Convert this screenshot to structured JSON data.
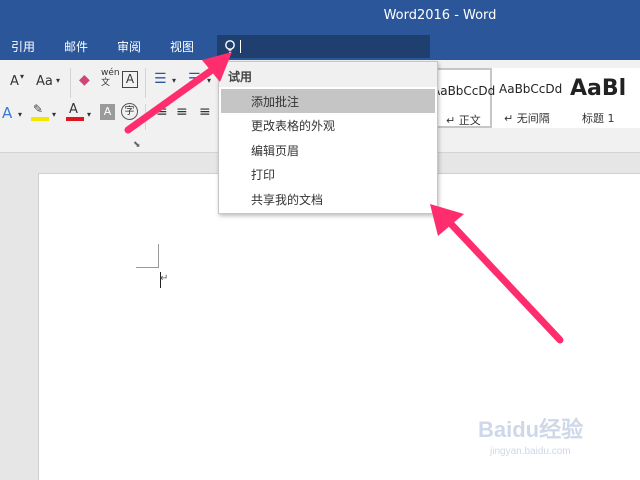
{
  "window": {
    "title": "Word2016 - Word"
  },
  "tabs": [
    {
      "label": "引用"
    },
    {
      "label": "邮件"
    },
    {
      "label": "审阅"
    },
    {
      "label": "视图"
    }
  ],
  "tellme": {
    "value": ""
  },
  "ribbon": {
    "font_size_up": "A",
    "case_button": "Aa",
    "phonetic_top": "wén",
    "phonetic_bottom": "文",
    "char_border": "A",
    "text_effects": "A",
    "font_color": "A",
    "char_shading": "A",
    "enclosed_char": "字"
  },
  "styles": [
    {
      "sample": "AaBbCcDd",
      "name": "正文",
      "prefix": "↵"
    },
    {
      "sample": "AaBbCcDd",
      "name": "无间隔",
      "prefix": "↵"
    },
    {
      "sample": "AaBl",
      "name": "标题 1",
      "prefix": ""
    }
  ],
  "dropdown": {
    "header": "试用",
    "items": [
      {
        "label": "添加批注"
      },
      {
        "label": "更改表格的外观"
      },
      {
        "label": "编辑页眉"
      },
      {
        "label": "打印"
      },
      {
        "label": "共享我的文档"
      }
    ]
  },
  "document": {
    "paragraph_mark": "↵"
  },
  "watermark": {
    "brand": "Baidu经验",
    "url": "jingyan.baidu.com"
  },
  "colors": {
    "titlebar": "#2b579a",
    "tellme_bg": "#1f3f6e",
    "ribbon_bg": "#f1f1f1",
    "dropdown_highlight": "#c5c5c5",
    "arrow": "#ff2d6e"
  }
}
